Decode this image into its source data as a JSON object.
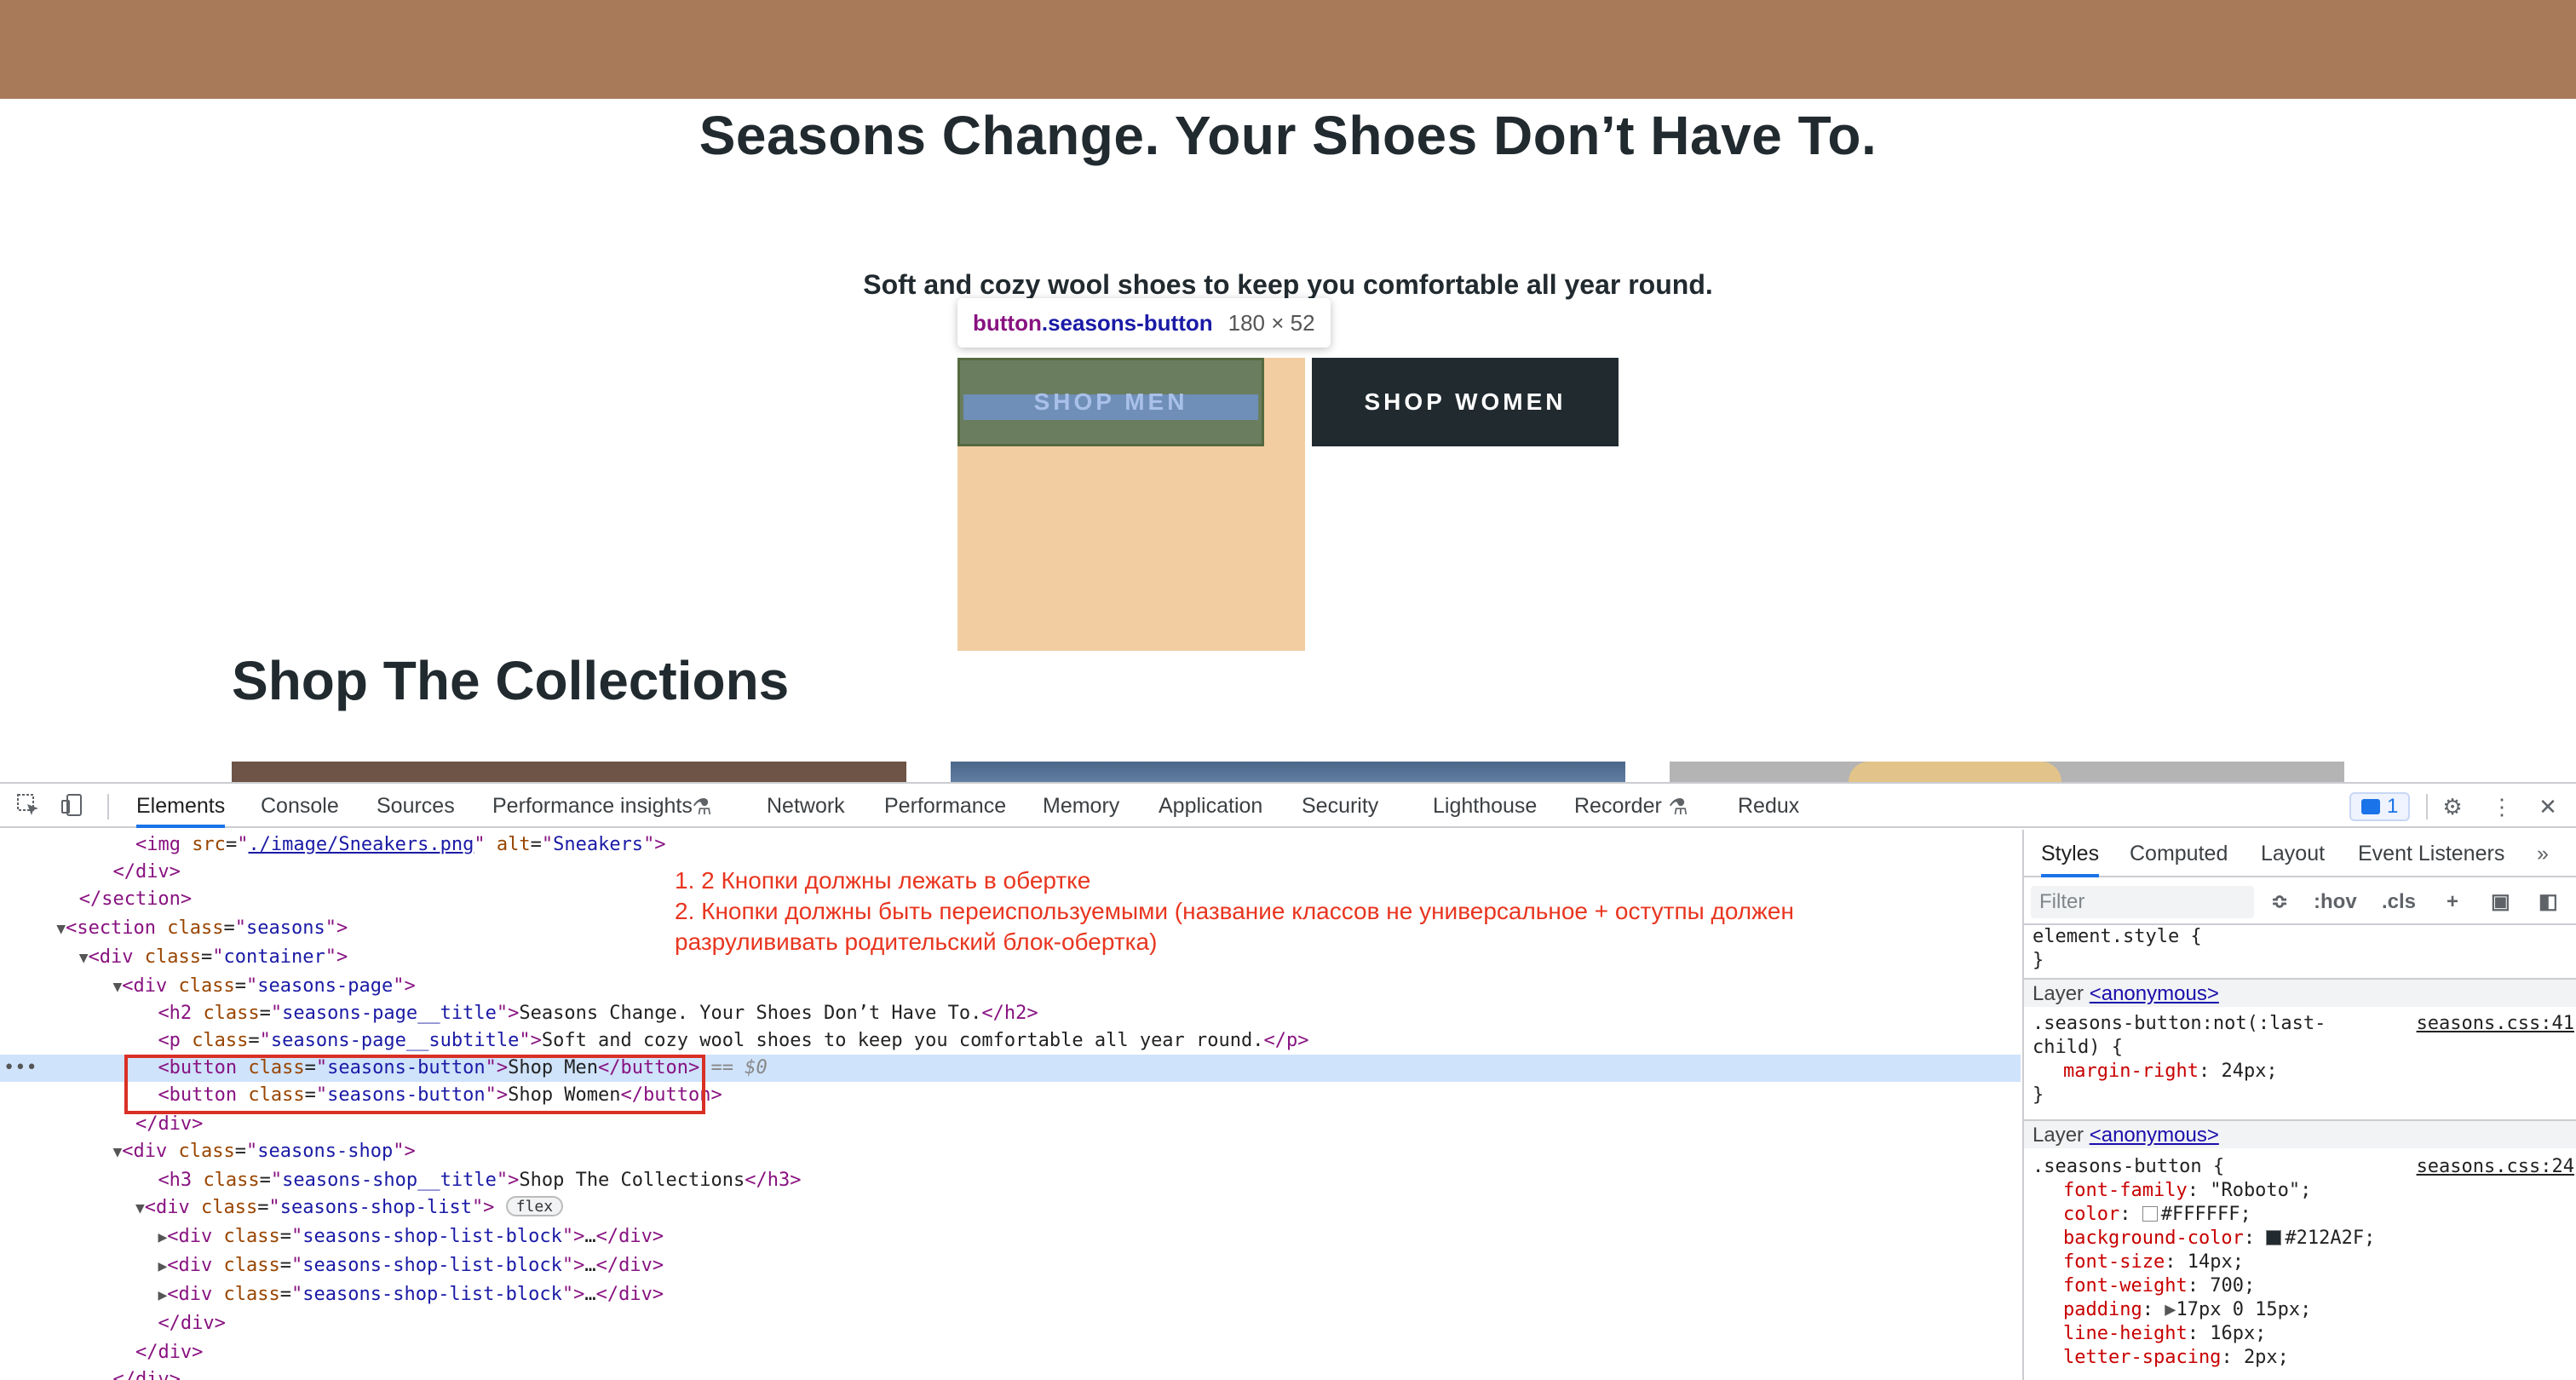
{
  "site": {
    "hero_title": "Seasons Change. Your Shoes Don’t Have To.",
    "hero_subtitle": "Soft and cozy wool shoes to keep you comfortable all year round.",
    "button_men": "SHOP MEN",
    "button_women": "SHOP WOMEN",
    "tooltip": {
      "tag": "button",
      "class": ".seasons-button",
      "size": "180 × 52"
    },
    "section_title": "Shop The Collections",
    "colors": {
      "topbar": "#a87a5a",
      "dark": "#212a2f",
      "margin_overlay": "#f2cda2"
    }
  },
  "devtools": {
    "tabs": [
      "Elements",
      "Console",
      "Sources",
      "Performance insights",
      "Network",
      "Performance",
      "Memory",
      "Application",
      "Security",
      "Lighthouse",
      "Recorder",
      "Redux"
    ],
    "active_tab": "Elements",
    "issues_count": "1",
    "icons": [
      "inspect-icon",
      "device-toolbar-icon",
      "flask-icon",
      "settings-icon",
      "more-icon",
      "close-icon"
    ],
    "dom": {
      "img_src": "./image/Sneakers.png",
      "img_alt": "Sneakers",
      "section_class": "seasons",
      "container_class": "container",
      "page_class": "seasons-page",
      "h2_class": "seasons-page__title",
      "h2_text": "Seasons Change. Your Shoes Don’t Have To.",
      "p_class": "seasons-page__subtitle",
      "p_text": "Soft and cozy wool shoes to keep you comfortable all year round.",
      "button_class": "seasons-button",
      "button1_text": "Shop Men",
      "button2_text": "Shop Women",
      "selected_marker": "$0",
      "shop_class": "seasons-shop",
      "h3_class": "seasons-shop__title",
      "h3_text": "Shop The Collections",
      "list_class": "seasons-shop-list",
      "flex_badge": "flex",
      "block_class": "seasons-shop-list-block"
    },
    "notes": [
      "1. 2 Кнопки должны лежать в обертке",
      "2. Кнопки должны быть переиспользуемыми (название классов не универсальное + остутпы должен",
      "разрулививать родительский блок-обертка)"
    ],
    "styles": {
      "tabs": [
        "Styles",
        "Computed",
        "Layout",
        "Event Listeners"
      ],
      "filter_placeholder": "Filter",
      "tools": [
        ":hov",
        ".cls"
      ],
      "element_style": "element.style {",
      "layer_label": "Layer",
      "layer_link": "<anonymous>",
      "rule1": {
        "selector_1": ".seasons-button:not(:last-",
        "selector_2": "child) {",
        "source": "seasons.css:41",
        "props": [
          {
            "name": "margin-right",
            "value": "24px;"
          }
        ]
      },
      "rule2": {
        "selector": ".seasons-button {",
        "source": "seasons.css:24",
        "props": [
          {
            "name": "font-family",
            "value": "\"Roboto\";"
          },
          {
            "name": "color",
            "value": "#FFFFFF;",
            "swatch": "#ffffff"
          },
          {
            "name": "background-color",
            "value": "#212A2F;",
            "swatch": "#212a2f"
          },
          {
            "name": "font-size",
            "value": "14px;"
          },
          {
            "name": "font-weight",
            "value": "700;"
          },
          {
            "name": "padding",
            "value": "17px 0 15px;"
          },
          {
            "name": "line-height",
            "value": "16px;"
          },
          {
            "name": "letter-spacing",
            "value": "2px;"
          }
        ]
      }
    }
  }
}
